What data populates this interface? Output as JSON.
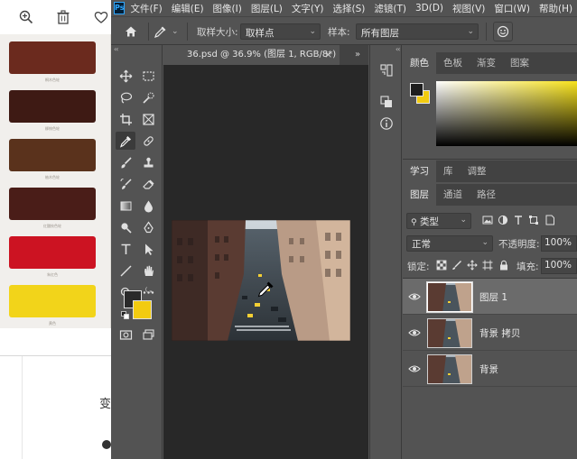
{
  "viewer": {
    "toolbar": {
      "zoom_icon": "zoom-in-icon",
      "delete_icon": "trash-icon",
      "favorite_icon": "heart-icon"
    },
    "swatches": [
      {
        "color": "#6b2a1e",
        "label": "桐木色轮"
      },
      {
        "color": "#3e1a14",
        "label": "柳桉色轮"
      },
      {
        "color": "#5a321c",
        "label": "柚木色轮"
      },
      {
        "color": "#4a1d18",
        "label": "红酸枝色轮"
      },
      {
        "color": "#cc1322",
        "label": "朱红色"
      },
      {
        "color": "#f2d41a",
        "label": "黄色"
      }
    ],
    "partial_text": "变"
  },
  "app": {
    "logo": "Ps",
    "menu": [
      "文件(F)",
      "编辑(E)",
      "图像(I)",
      "图层(L)",
      "文字(Y)",
      "选择(S)",
      "滤镜(T)",
      "3D(D)",
      "视图(V)",
      "窗口(W)",
      "帮助(H)"
    ]
  },
  "options_bar": {
    "sample_size_label": "取样大小:",
    "sample_size_value": "取样点",
    "sample_label": "样本:",
    "sample_value": "所有图层"
  },
  "document": {
    "tab_title": "36.psd @ 36.9% (图层 1, RGB/8*)",
    "close": "×",
    "overflow": "»"
  },
  "tools_collapse": "‹‹",
  "colors": {
    "foreground": "#2a2a2a",
    "background": "#f2cb10",
    "accent": "#31a8ff"
  },
  "color_panel": {
    "tabs": [
      "颜色",
      "色板",
      "渐变",
      "图案"
    ],
    "active_tab": "颜色"
  },
  "learn_panel": {
    "tabs": [
      "学习",
      "库",
      "调整"
    ],
    "active_tab": "学习"
  },
  "layers_panel": {
    "tabs": [
      "图层",
      "通道",
      "路径"
    ],
    "active_tab": "图层",
    "filter_label": "类型",
    "blend_mode": "正常",
    "opacity_label": "不透明度:",
    "opacity_value": "100%",
    "lock_label": "锁定:",
    "fill_label": "填充:",
    "fill_value": "100%",
    "layers": [
      {
        "name": "图层 1",
        "selected": true
      },
      {
        "name": "背景 拷贝",
        "selected": false
      },
      {
        "name": "背景",
        "selected": false
      }
    ]
  }
}
